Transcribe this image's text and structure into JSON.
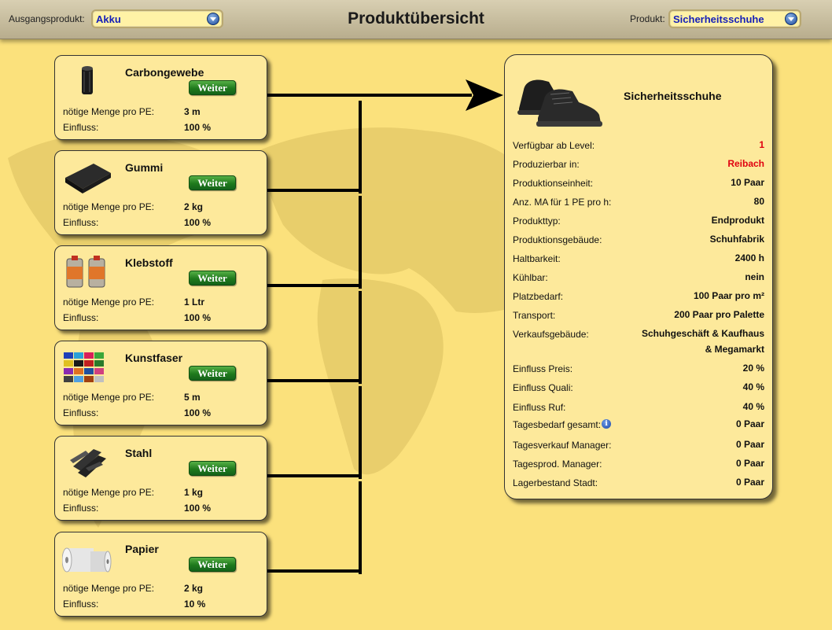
{
  "header": {
    "source_label": "Ausgangsprodukt:",
    "source_value": "Akku",
    "title": "Produktübersicht",
    "product_label": "Produkt:",
    "product_value": "Sicherheitsschuhe"
  },
  "ingredients": [
    {
      "name": "Carbongewebe",
      "icon": "carbon-roll-icon",
      "button": "Weiter",
      "qty_label": "nötige Menge pro PE:",
      "qty": "3 m",
      "influence_label": "Einfluss:",
      "influence": "100 %"
    },
    {
      "name": "Gummi",
      "icon": "rubber-sheet-icon",
      "button": "Weiter",
      "qty_label": "nötige Menge pro PE:",
      "qty": "2 kg",
      "influence_label": "Einfluss:",
      "influence": "100 %"
    },
    {
      "name": "Klebstoff",
      "icon": "glue-cans-icon",
      "button": "Weiter",
      "qty_label": "nötige Menge pro PE:",
      "qty": "1 Ltr",
      "influence_label": "Einfluss:",
      "influence": "100 %"
    },
    {
      "name": "Kunstfaser",
      "icon": "thread-spools-icon",
      "button": "Weiter",
      "qty_label": "nötige Menge pro PE:",
      "qty": "5 m",
      "influence_label": "Einfluss:",
      "influence": "100 %"
    },
    {
      "name": "Stahl",
      "icon": "steel-beams-icon",
      "button": "Weiter",
      "qty_label": "nötige Menge pro PE:",
      "qty": "1 kg",
      "influence_label": "Einfluss:",
      "influence": "100 %"
    },
    {
      "name": "Papier",
      "icon": "paper-rolls-icon",
      "button": "Weiter",
      "qty_label": "nötige Menge pro PE:",
      "qty": "2 kg",
      "influence_label": "Einfluss:",
      "influence": "10 %"
    }
  ],
  "product": {
    "name": "Sicherheitsschuhe",
    "icon": "safety-boots-icon",
    "rows": [
      {
        "label": "Verfügbar ab Level:",
        "value": "1",
        "color": "#e0000f"
      },
      {
        "label": "Produzierbar in:",
        "value": "Reibach",
        "color": "#e0000f"
      },
      {
        "label": "Produktionseinheit:",
        "value": "10 Paar"
      },
      {
        "label": "Anz. MA für 1 PE pro h:",
        "value": "80"
      },
      {
        "label": "Produkttyp:",
        "value": "Endprodukt"
      },
      {
        "label": "Produktionsgebäude:",
        "value": "Schuhfabrik"
      },
      {
        "label": "Haltbarkeit:",
        "value": "2400 h"
      },
      {
        "label": "Kühlbar:",
        "value": "nein"
      },
      {
        "label": "Platzbedarf:",
        "value": "100 Paar pro m²"
      },
      {
        "label": "Transport:",
        "value": "200 Paar pro Palette"
      },
      {
        "label": "Verkaufsgebäude:",
        "value": "Schuhgeschäft & Kaufhaus",
        "value2": "& Megamarkt"
      },
      {
        "label": "Einfluss Preis:",
        "value": "20 %"
      },
      {
        "label": "Einfluss Quali:",
        "value": "40 %"
      },
      {
        "label": "Einfluss Ruf:",
        "value": "40 %"
      },
      {
        "label": "Tagesbedarf gesamt:",
        "value": "0 Paar",
        "info": "i"
      },
      {
        "label": "Tagesverkauf Manager:",
        "value": "0 Paar"
      },
      {
        "label": "Tagesprod. Manager:",
        "value": "0 Paar"
      },
      {
        "label": "Lagerbestand Stadt:",
        "value": "0 Paar"
      }
    ]
  }
}
